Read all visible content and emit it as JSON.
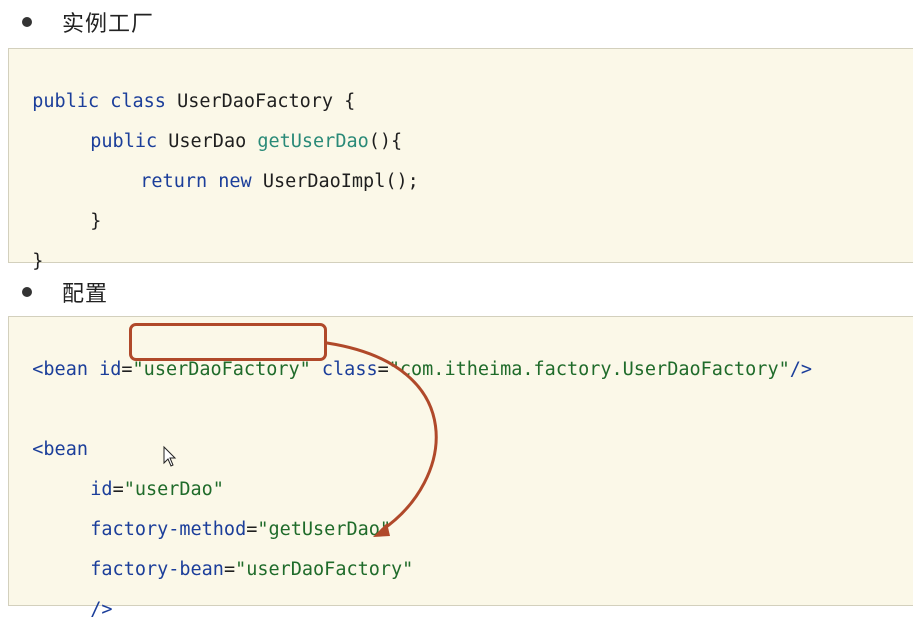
{
  "section1": {
    "title": "实例工厂"
  },
  "section2": {
    "title": "配置"
  },
  "factory_code": {
    "l1": {
      "kw1": "public",
      "kw2": "class",
      "name": "UserDaoFactory",
      "brace": " {"
    },
    "l2": {
      "kw": "public",
      "type": "UserDao",
      "method": "getUserDao",
      "tail": "(){"
    },
    "l3": {
      "kw1": "return",
      "kw2": "new",
      "rest": "UserDaoImpl();"
    },
    "l4": {
      "text": "}"
    },
    "l5": {
      "text": "}"
    }
  },
  "config_code": {
    "bean1": {
      "open": "<bean",
      "id_attr": "id",
      "eq": "=",
      "id_value": "\"userDaoFactory\"",
      "class_attr": "class",
      "class_value": "\"com.itheima.factory.UserDaoFactory\"",
      "close": "/>"
    },
    "bean2": {
      "open": "<bean",
      "id_attr": "id",
      "id_value": "\"userDao\"",
      "fm_attr": "factory-method",
      "fm_value": "\"getUserDao\"",
      "fb_attr": "factory-bean",
      "fb_value": "\"userDaoFactory\"",
      "close": "/>"
    }
  },
  "annotation": {
    "color": "#b0492a"
  }
}
